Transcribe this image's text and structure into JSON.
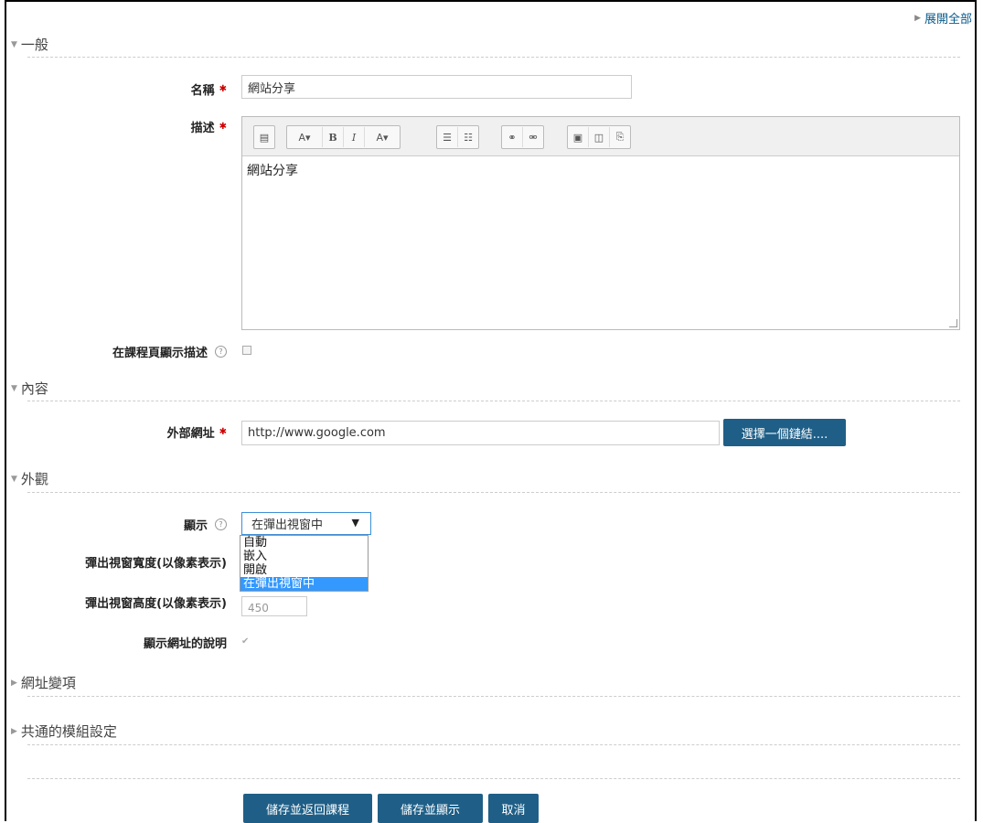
{
  "header": {
    "expand_all": "展開全部"
  },
  "sections": {
    "general": "一般",
    "content": "內容",
    "appearance": "外觀",
    "url_variables": "網址變項",
    "common_settings": "共通的模組設定"
  },
  "fields": {
    "name_label": "名稱",
    "name_value": "網站分享",
    "description_label": "描述",
    "description_value": "網站分享",
    "show_description_label": "在課程頁顯示描述",
    "external_url_label": "外部網址",
    "external_url_value": "http://www.google.com",
    "choose_link_button": "選擇一個鏈結....",
    "display_label": "顯示",
    "display_selected": "在彈出視窗中",
    "display_options": [
      "自動",
      "嵌入",
      "開啟",
      "在彈出視窗中"
    ],
    "popup_width_label": "彈出視窗寬度(以像素表示)",
    "popup_height_label": "彈出視窗高度(以像素表示)",
    "popup_height_value": "450",
    "show_url_description_label": "顯示網址的說明"
  },
  "toolbar_icons": [
    "toolbar-toggle-icon",
    "style-icon",
    "bold-icon",
    "italic-icon",
    "font-color-icon",
    "unordered-list-icon",
    "ordered-list-icon",
    "link-icon",
    "unlink-icon",
    "image-icon",
    "media-icon",
    "manage-files-icon"
  ],
  "buttons": {
    "save_return": "儲存並返回課程",
    "save_display": "儲存並顯示",
    "cancel": "取消"
  },
  "colors": {
    "button": "#1f5f87",
    "link": "#0a5a8a",
    "select_highlight": "#3399ff",
    "required": "#cc0000"
  }
}
